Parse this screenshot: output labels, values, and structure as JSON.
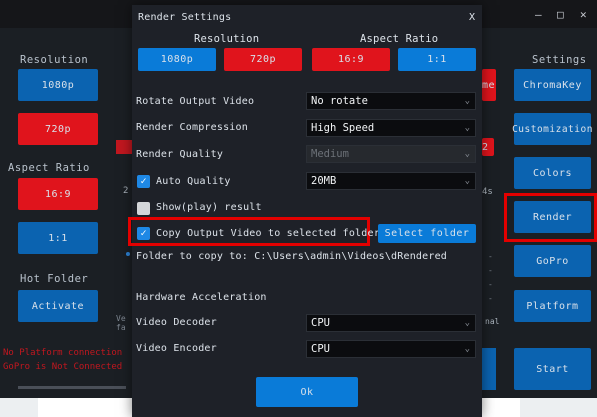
{
  "window_controls": {
    "minimize": "–",
    "maximize": "□",
    "close": "✕"
  },
  "left_panel": {
    "resolution_label": "Resolution",
    "res_1080": "1080p",
    "res_720": "720p",
    "aspect_label": "Aspect Ratio",
    "ar_169": "16:9",
    "ar_11": "1:1",
    "hot_folder_label": "Hot Folder",
    "activate": "Activate"
  },
  "right_panel": {
    "settings_label": "Settings",
    "chromakey": "ChromaKey",
    "customization": "Customization",
    "colors": "Colors",
    "render": "Render",
    "gopro": "GoPro",
    "platform": "Platform",
    "start": "Start"
  },
  "background_fragments": {
    "me": "me",
    "two": "2",
    "four_s": "4s",
    "ve": "Ve",
    "fa": "fa",
    "nal": "nal",
    "left_2": "2",
    "dash1": "-",
    "dash2": "-",
    "dash3": "-",
    "dash4": "-"
  },
  "status": {
    "platform": "No Platform connection",
    "gopro": "GoPro is Not Connected"
  },
  "modal": {
    "title": "Render Settings",
    "close": "X",
    "resolution_header": "Resolution",
    "aspect_header": "Aspect Ratio",
    "res_1080": "1080p",
    "res_720": "720p",
    "ar_169": "16:9",
    "ar_11": "1:1",
    "rotate_label": "Rotate Output Video",
    "rotate_value": "No rotate",
    "compression_label": "Render Compression",
    "compression_value": "High Speed",
    "quality_label": "Render Quality",
    "quality_value": "Medium",
    "auto_quality_label": "Auto Quality",
    "auto_quality_checked": true,
    "auto_quality_value": "20MB",
    "show_result_label": "Show(play) result",
    "show_result_checked": false,
    "copy_label": "Copy Output Video to selected folder",
    "copy_checked": true,
    "select_folder": "Select folder",
    "folder_text": "Folder to copy to: C:\\Users\\admin\\Videos\\dRendered",
    "hw_header": "Hardware Acceleration",
    "decoder_label": "Video Decoder",
    "decoder_value": "CPU",
    "encoder_label": "Video Encoder",
    "encoder_value": "CPU",
    "ok": "Ok"
  },
  "colors": {
    "blue": "#0b63b0",
    "red": "#e0141c",
    "highlight": "#e30000",
    "check_blue": "#1e88e5"
  }
}
